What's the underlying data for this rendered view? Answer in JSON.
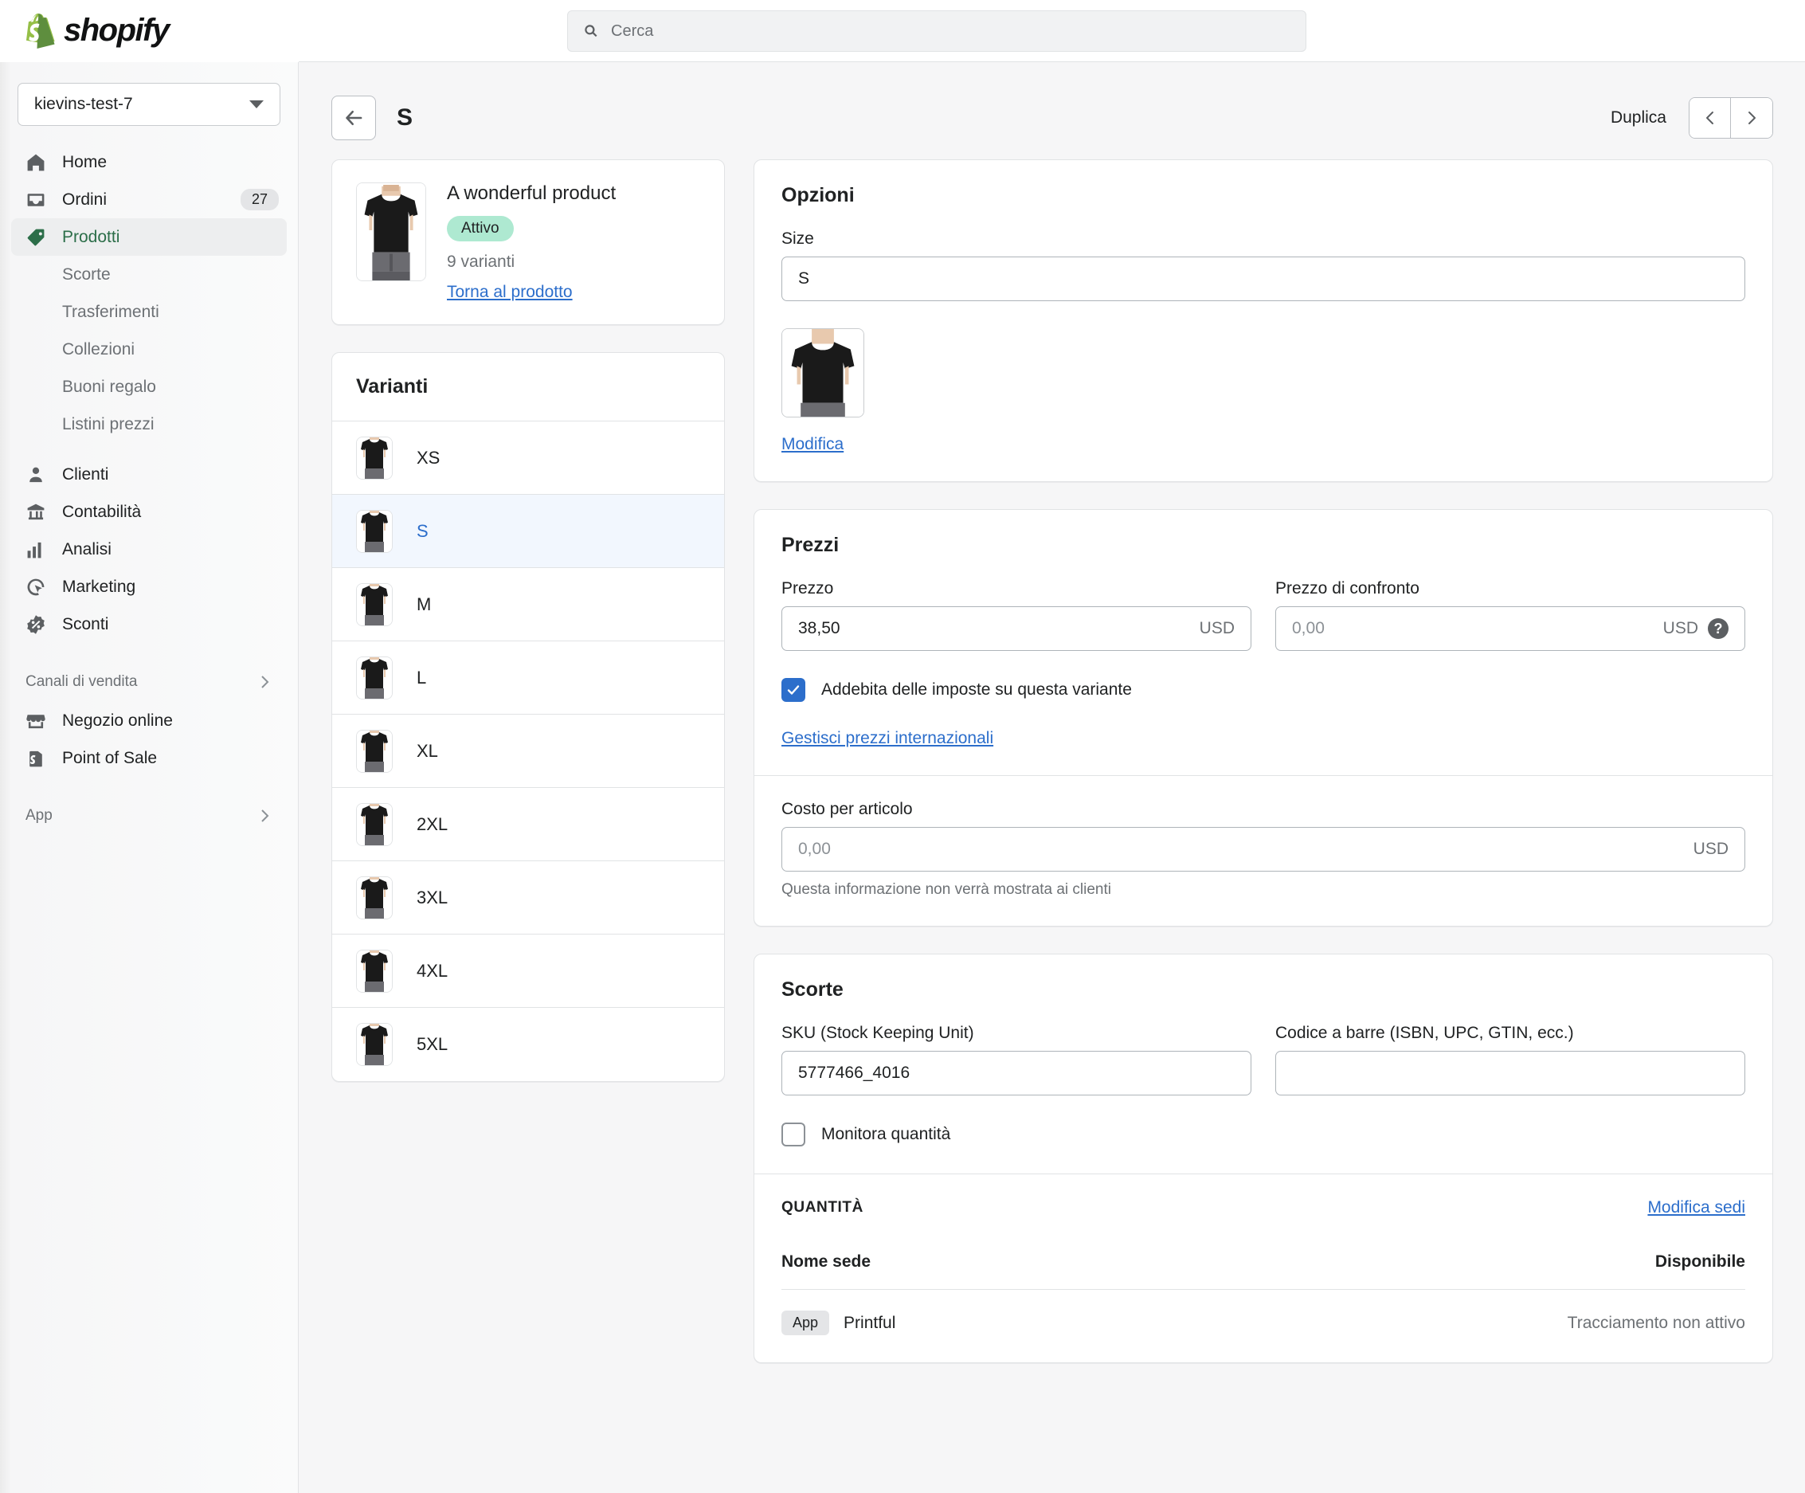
{
  "brand": {
    "name": "shopify",
    "logo_icon": "shopify-bag-logo"
  },
  "search": {
    "placeholder": "Cerca",
    "icon": "search-icon"
  },
  "sidebar": {
    "store": {
      "name": "kievins-test-7",
      "caret_icon": "chevron-down-icon"
    },
    "items": [
      {
        "label": "Home",
        "icon": "home-icon",
        "badge": ""
      },
      {
        "label": "Ordini",
        "icon": "orders-inbox-icon",
        "badge": "27"
      },
      {
        "label": "Prodotti",
        "icon": "product-tag-icon",
        "badge": "",
        "active": true
      }
    ],
    "sub_items": [
      {
        "label": "Scorte"
      },
      {
        "label": "Trasferimenti"
      },
      {
        "label": "Collezioni"
      },
      {
        "label": "Buoni regalo"
      },
      {
        "label": "Listini prezzi"
      }
    ],
    "items2": [
      {
        "label": "Clienti",
        "icon": "customer-person-icon"
      },
      {
        "label": "Contabilità",
        "icon": "bank-building-icon"
      },
      {
        "label": "Analisi",
        "icon": "bar-chart-icon"
      },
      {
        "label": "Marketing",
        "icon": "marketing-cursor-icon"
      },
      {
        "label": "Sconti",
        "icon": "discount-percent-icon"
      }
    ],
    "section_sales": {
      "label": "Canali di vendita",
      "icon": "chevron-right-icon"
    },
    "sales_items": [
      {
        "label": "Negozio online",
        "icon": "online-store-icon"
      },
      {
        "label": "Point of Sale",
        "icon": "point-of-sale-icon"
      }
    ],
    "section_apps": {
      "label": "App",
      "icon": "chevron-right-icon"
    }
  },
  "header": {
    "back_icon": "arrow-left-icon",
    "title": "S",
    "duplicate_label": "Duplica",
    "prev_icon": "chevron-left-icon",
    "next_icon": "chevron-right-icon"
  },
  "product": {
    "name": "A wonderful product",
    "status": "Attivo",
    "variant_count": "9 varianti",
    "back_link": "Torna al prodotto",
    "image_alt": "black-tshirt-thumbnail"
  },
  "variants_card": {
    "title": "Varianti",
    "rows": [
      {
        "label": "XS",
        "selected": false
      },
      {
        "label": "S",
        "selected": true
      },
      {
        "label": "M",
        "selected": false
      },
      {
        "label": "L",
        "selected": false
      },
      {
        "label": "XL",
        "selected": false
      },
      {
        "label": "2XL",
        "selected": false
      },
      {
        "label": "3XL",
        "selected": false
      },
      {
        "label": "4XL",
        "selected": false
      },
      {
        "label": "5XL",
        "selected": false
      }
    ]
  },
  "options": {
    "title": "Opzioni",
    "size_label": "Size",
    "size_value": "S",
    "edit_link": "Modifica",
    "image_alt": "variant-image-thumbnail"
  },
  "pricing": {
    "title": "Prezzi",
    "price_label": "Prezzo",
    "price_value": "38,50",
    "price_currency": "USD",
    "compare_label": "Prezzo di confronto",
    "compare_placeholder": "0,00",
    "compare_currency": "USD",
    "help_icon": "help-question-icon",
    "tax_checkbox_label": "Addebita delle imposte su questa variante",
    "tax_checked": true,
    "intl_link": "Gestisci prezzi internazionali",
    "cost_label": "Costo per articolo",
    "cost_placeholder": "0,00",
    "cost_currency": "USD",
    "cost_hint": "Questa informazione non verrà mostrata ai clienti"
  },
  "inventory": {
    "title": "Scorte",
    "sku_label": "SKU (Stock Keeping Unit)",
    "sku_value": "5777466_4016",
    "barcode_label": "Codice a barre (ISBN, UPC, GTIN, ecc.)",
    "barcode_value": "",
    "track_label": "Monitora quantità",
    "track_checked": false,
    "quantity_title": "QUANTITÀ",
    "edit_locations_link": "Modifica sedi",
    "table": {
      "columns": [
        "Nome sede",
        "Disponibile"
      ],
      "rows": [
        {
          "pill": "App",
          "name": "Printful",
          "available": "Tracciamento non attivo"
        }
      ]
    }
  },
  "colors": {
    "accent_blue": "#2C6ECB",
    "active_green": "#2C6E49",
    "badge_green": "#AEE9D1",
    "page_bg": "#F6F6F7",
    "border": "#E1E3E5"
  }
}
